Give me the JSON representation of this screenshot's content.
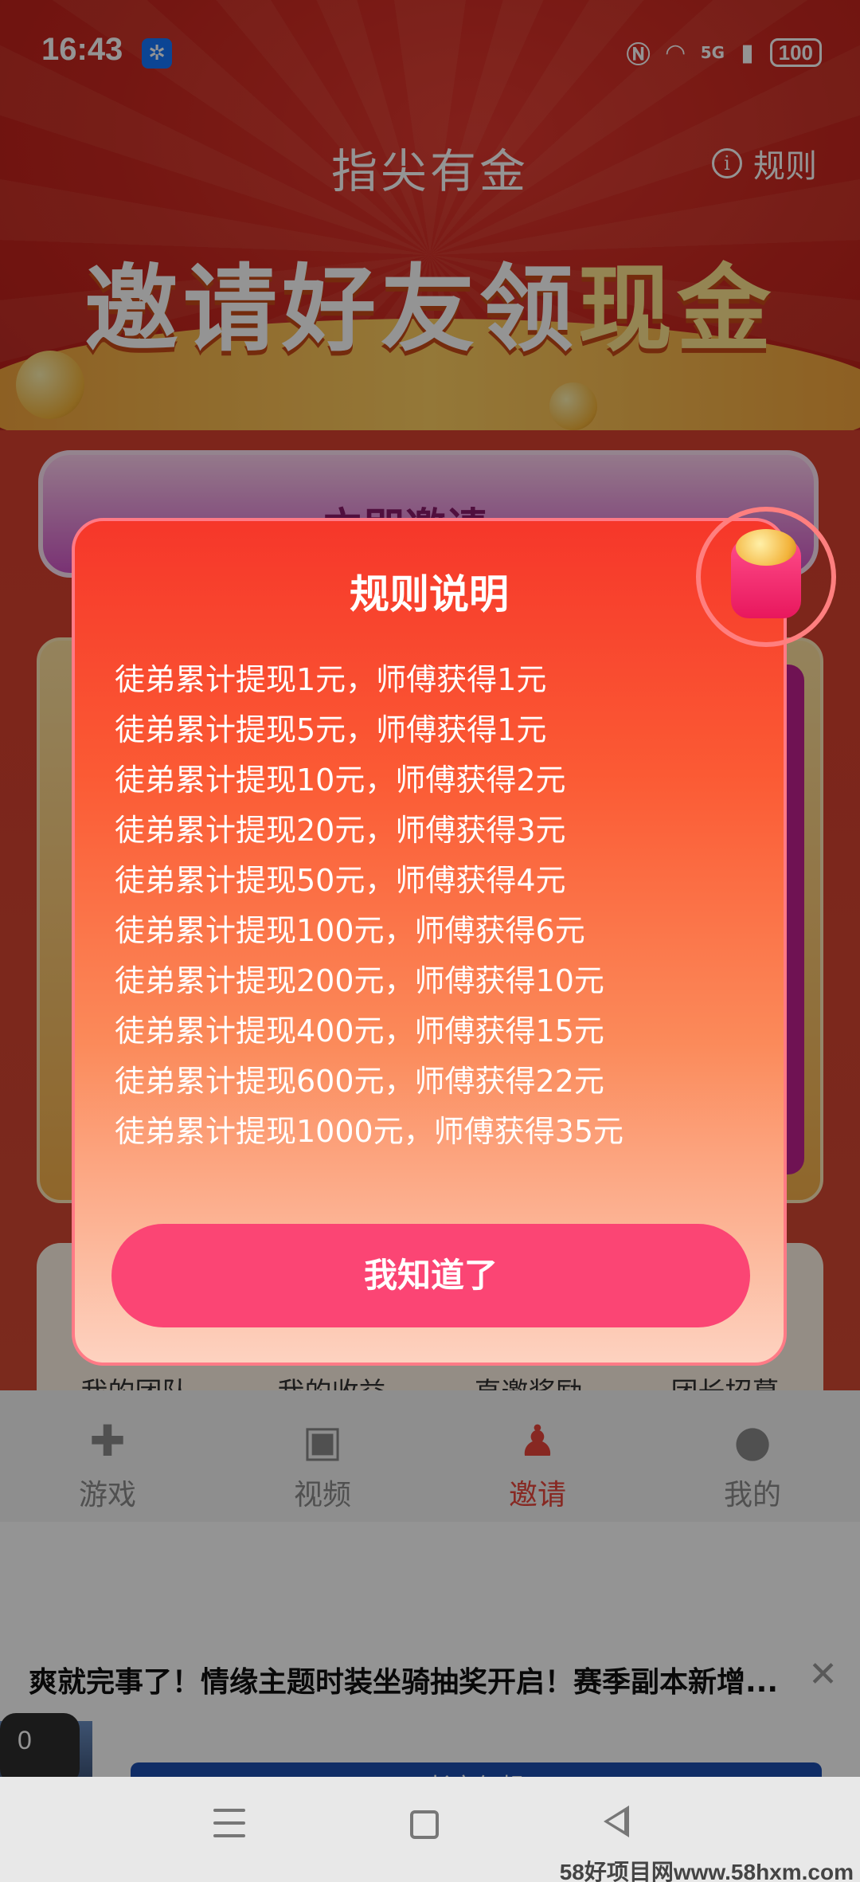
{
  "status_bar": {
    "time": "16:43",
    "battery": "100",
    "network": "5G"
  },
  "header": {
    "title": "指尖有金",
    "rules_label": "规则"
  },
  "banner": {
    "text_white": "邀请好友领",
    "text_gold": "现金"
  },
  "background": {
    "invite_button_label": "立即邀请",
    "stats_labels": [
      "我的团队",
      "我的收益",
      "直邀奖励",
      "团长招募"
    ]
  },
  "tabs": [
    {
      "label": "游戏",
      "icon": "gamepad-icon",
      "active": false
    },
    {
      "label": "视频",
      "icon": "video-icon",
      "active": false
    },
    {
      "label": "邀请",
      "icon": "add-user-icon",
      "active": true
    },
    {
      "label": "我的",
      "icon": "user-icon",
      "active": false
    }
  ],
  "ad": {
    "text": "爽就完事了！情缘主题时装坐骑抽奖开启！赛季副本新增...",
    "badge": "0",
    "cta": "长安幻想"
  },
  "modal": {
    "title": "规则说明",
    "rules": [
      "徒弟累计提现1元，师傅获得1元",
      "徒弟累计提现5元，师傅获得1元",
      "徒弟累计提现10元，师傅获得2元",
      "徒弟累计提现20元，师傅获得3元",
      "徒弟累计提现50元，师傅获得4元",
      "徒弟累计提现100元，师傅获得6元",
      "徒弟累计提现200元，师傅获得10元",
      "徒弟累计提现400元，师傅获得15元",
      "徒弟累计提现600元，师傅获得22元",
      "徒弟累计提现1000元，师傅获得35元"
    ],
    "confirm_label": "我知道了"
  },
  "watermark": "58好项目网www.58hxm.com",
  "colors": {
    "accent": "#fb4574",
    "modal_top": "#f6372a",
    "modal_bottom": "#fdd2c0",
    "tab_active": "#e8453c"
  }
}
